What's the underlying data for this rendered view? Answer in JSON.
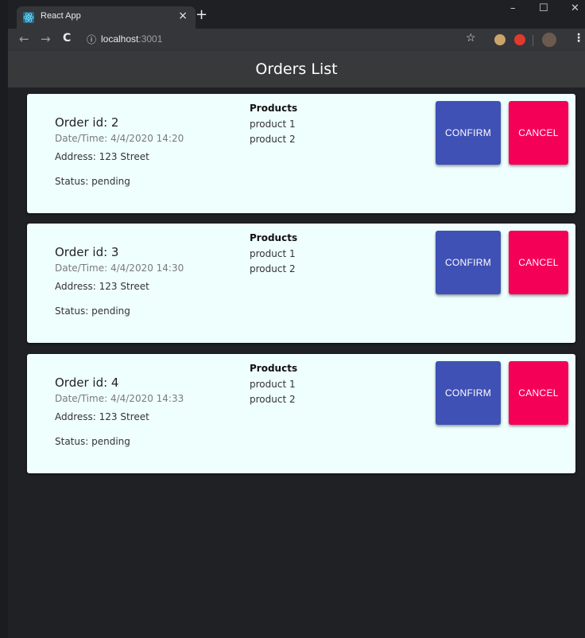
{
  "browser": {
    "tab_title": "React App",
    "tab_close": "×",
    "new_tab": "+",
    "window_controls": {
      "minimize": "–",
      "maximize": "☐",
      "close": "✕"
    },
    "nav": {
      "back": "←",
      "forward": "→",
      "reload": "C"
    },
    "url_icon": "ⓘ",
    "url_host": "localhost",
    "url_port": ":3001",
    "bookmark_icon": "☆",
    "menu_icon": "⋮"
  },
  "app": {
    "title": "Orders List"
  },
  "colors": {
    "confirm": "#3f51b5",
    "cancel": "#f50057",
    "card_bg": "#effffe",
    "header_bg": "#37393b",
    "page_bg": "#202124"
  },
  "orders": [
    {
      "id_label": "Order id: 2",
      "datetime": "Date/Time: 4/4/2020 14:20",
      "address": "Address: 123 Street",
      "status": "Status: pending",
      "products_heading": "Products",
      "products": [
        "product 1",
        "product 2"
      ],
      "confirm_label": "CONFIRM",
      "cancel_label": "CANCEL"
    },
    {
      "id_label": "Order id: 3",
      "datetime": "Date/Time: 4/4/2020 14:30",
      "address": "Address: 123 Street",
      "status": "Status: pending",
      "products_heading": "Products",
      "products": [
        "product 1",
        "product 2"
      ],
      "confirm_label": "CONFIRM",
      "cancel_label": "CANCEL"
    },
    {
      "id_label": "Order id: 4",
      "datetime": "Date/Time: 4/4/2020 14:33",
      "address": "Address: 123 Street",
      "status": "Status: pending",
      "products_heading": "Products",
      "products": [
        "product 1",
        "product 2"
      ],
      "confirm_label": "CONFIRM",
      "cancel_label": "CANCEL"
    }
  ]
}
